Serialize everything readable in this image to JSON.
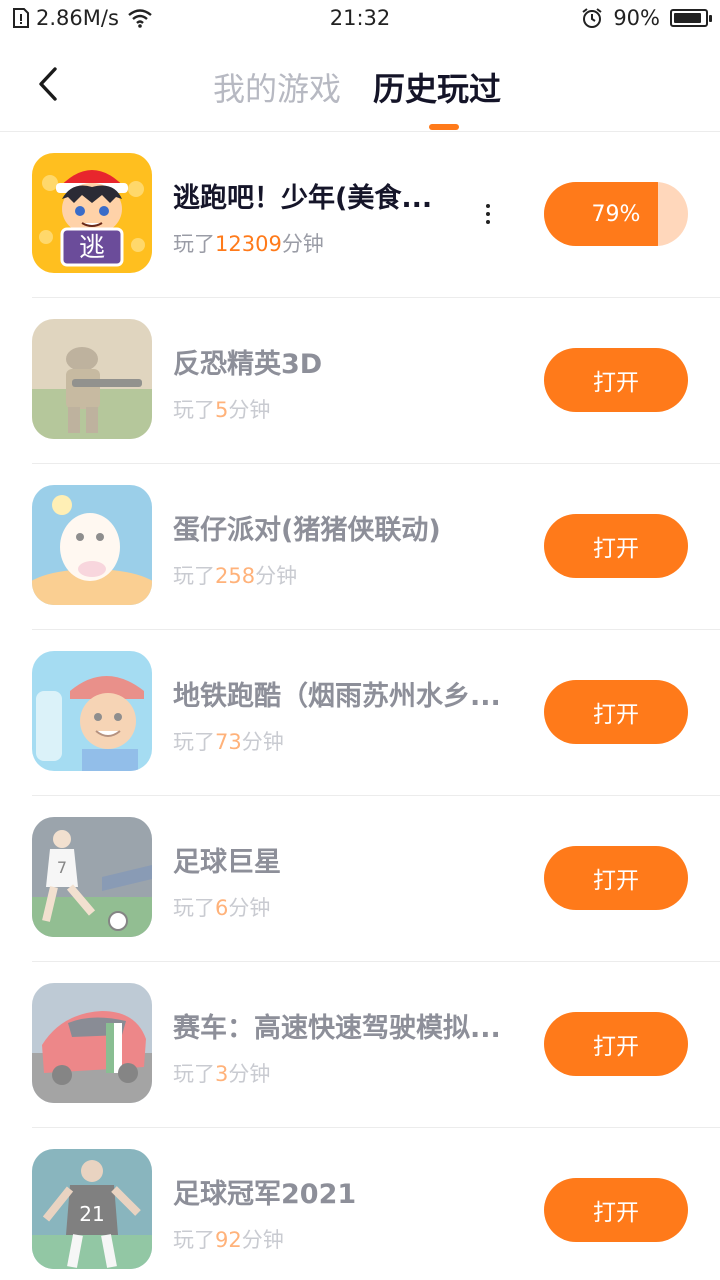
{
  "status_bar": {
    "speed": "2.86M/s",
    "time": "21:32",
    "battery_text": "90%",
    "battery_level": 0.9,
    "icons": [
      "sim-icon",
      "wifi-icon",
      "alarm-icon",
      "battery-icon"
    ]
  },
  "header": {
    "back_icon": "back-arrow-icon",
    "tabs": [
      {
        "label": "我的游戏",
        "selected": false
      },
      {
        "label": "历史玩过",
        "selected": true
      }
    ],
    "accent": "#ff7a1a"
  },
  "games": [
    {
      "title": "逃跑吧！少年(美食...",
      "played_prefix": "玩了",
      "minutes": "12309",
      "played_suffix": "分钟",
      "action": "79%",
      "progress": 0.79,
      "active": true,
      "more_icon": "more-vertical-icon"
    },
    {
      "title": "反恐精英3D",
      "played_prefix": "玩了",
      "minutes": "5",
      "played_suffix": "分钟",
      "action": "打开"
    },
    {
      "title": "蛋仔派对(猪猪侠联动)",
      "played_prefix": "玩了",
      "minutes": "258",
      "played_suffix": "分钟",
      "action": "打开"
    },
    {
      "title": "地铁跑酷（烟雨苏州水乡...",
      "played_prefix": "玩了",
      "minutes": "73",
      "played_suffix": "分钟",
      "action": "打开"
    },
    {
      "title": "足球巨星",
      "played_prefix": "玩了",
      "minutes": "6",
      "played_suffix": "分钟",
      "action": "打开"
    },
    {
      "title": "赛车：高速快速驾驶模拟...",
      "played_prefix": "玩了",
      "minutes": "3",
      "played_suffix": "分钟",
      "action": "打开"
    },
    {
      "title": "足球冠军2021",
      "played_prefix": "玩了",
      "minutes": "92",
      "played_suffix": "分钟",
      "action": "打开"
    }
  ],
  "icon_badges": {
    "game0": "逃",
    "game4": "7",
    "game6": "21"
  }
}
